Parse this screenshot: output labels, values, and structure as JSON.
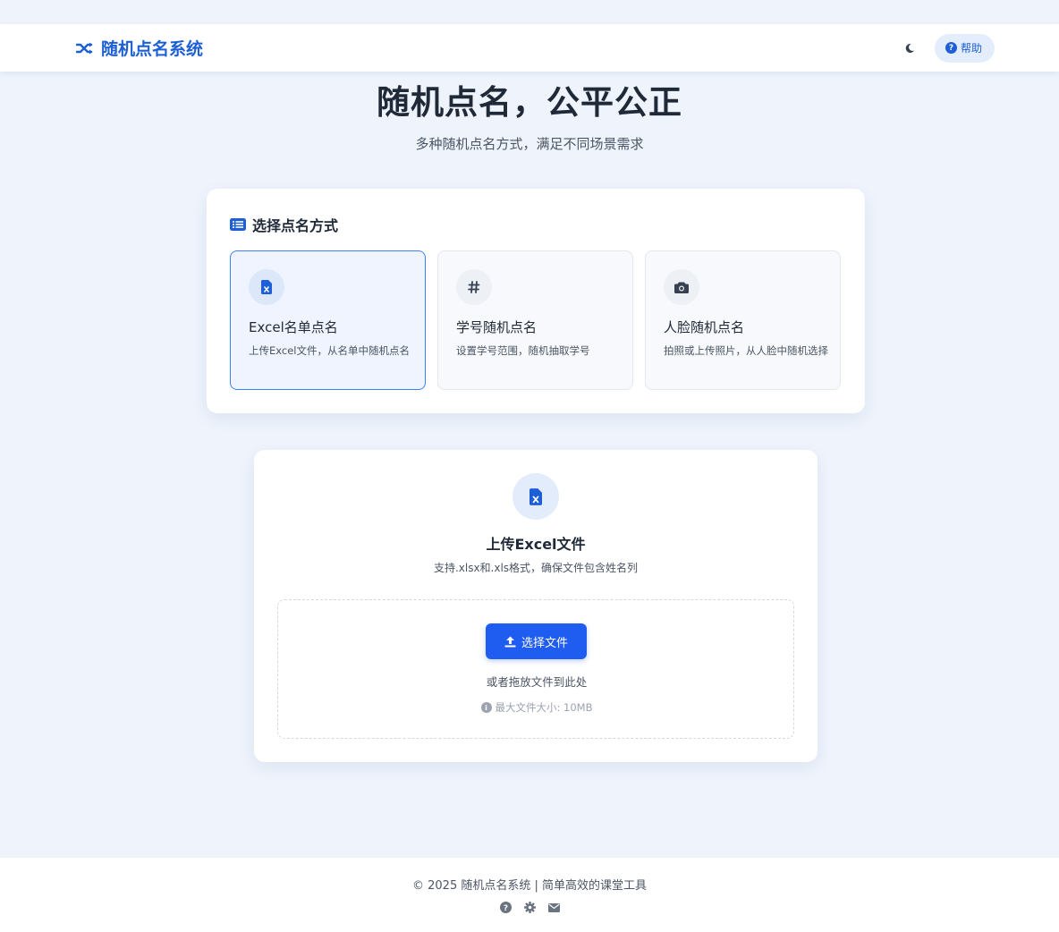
{
  "nav": {
    "brand": "随机点名系统",
    "brand_icon": "shuffle-icon",
    "theme_icon": "moon-icon",
    "help_label": "帮助",
    "help_icon": "question-circle-icon"
  },
  "hero": {
    "title": "随机点名，公平公正",
    "subtitle": "多种随机点名方式，满足不同场景需求"
  },
  "mode_select": {
    "heading": "选择点名方式",
    "heading_icon": "list-icon",
    "options": [
      {
        "title": "Excel名单点名",
        "desc": "上传Excel文件，从名单中随机点名",
        "icon": "excel-file-icon",
        "active": true
      },
      {
        "title": "学号随机点名",
        "desc": "设置学号范围，随机抽取学号",
        "icon": "hashtag-icon",
        "active": false
      },
      {
        "title": "人脸随机点名",
        "desc": "拍照或上传照片，从人脸中随机选择",
        "icon": "camera-icon",
        "active": false
      }
    ]
  },
  "upload": {
    "icon": "excel-file-icon",
    "title": "上传Excel文件",
    "desc": "支持.xlsx和.xls格式，确保文件包含姓名列",
    "button_label": "选择文件",
    "button_icon": "upload-icon",
    "drop_text": "或者拖放文件到此处",
    "max_size": "最大文件大小: 10MB",
    "info_icon": "info-circle-icon"
  },
  "footer": {
    "text": "© 2025 随机点名系统 | 简单高效的课堂工具",
    "icons": [
      "question-circle-icon",
      "gear-icon",
      "envelope-icon"
    ]
  },
  "colors": {
    "accent": "#1d5fd6",
    "button": "#1f5cf0",
    "background": "#eef3fc"
  }
}
